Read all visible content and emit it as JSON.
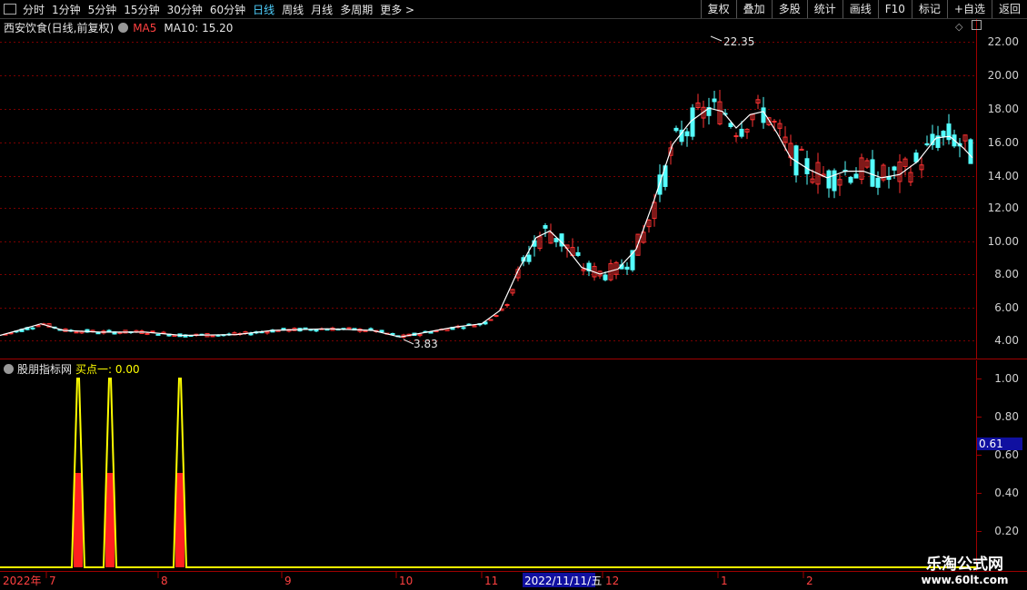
{
  "toolbar": {
    "periods": [
      "分时",
      "1分钟",
      "5分钟",
      "15分钟",
      "30分钟",
      "60分钟",
      "日线",
      "周线",
      "月线",
      "多周期",
      "更多 >"
    ],
    "active_period": "日线",
    "actions": [
      "复权",
      "叠加",
      "多股",
      "统计",
      "画线",
      "F10",
      "标记",
      "+自选",
      "返回"
    ]
  },
  "stock": {
    "name": "西安饮食(日线,前复权)",
    "ma5_label": "MA5",
    "ma10_label": "MA10: 15.20"
  },
  "price_axis": {
    "labels": [
      "22.00",
      "20.00",
      "18.00",
      "16.00",
      "14.00",
      "12.00",
      "10.00",
      "8.00",
      "6.00",
      "4.00"
    ],
    "high_label": "22.35",
    "low_label": "3.83"
  },
  "indicator": {
    "name": "股朋指标网",
    "value_label": "买点一: 0.00",
    "axis_labels": [
      "1.00",
      "0.80",
      "0.60",
      "0.40",
      "0.20"
    ],
    "cursor_value": "0.61"
  },
  "date_axis": {
    "labels": [
      "2022年",
      "7",
      "8",
      "9",
      "10",
      "11",
      "12",
      "1",
      "2"
    ],
    "highlight": "2022/11/11/五"
  },
  "watermark": {
    "line1": "乐淘公式网",
    "line2": "www.60lt.com"
  },
  "colors": {
    "up": "#ff3232",
    "down": "#54ffff",
    "grid": "#7a0000",
    "ma": "#ffffff",
    "signal": "#ffff00"
  }
}
